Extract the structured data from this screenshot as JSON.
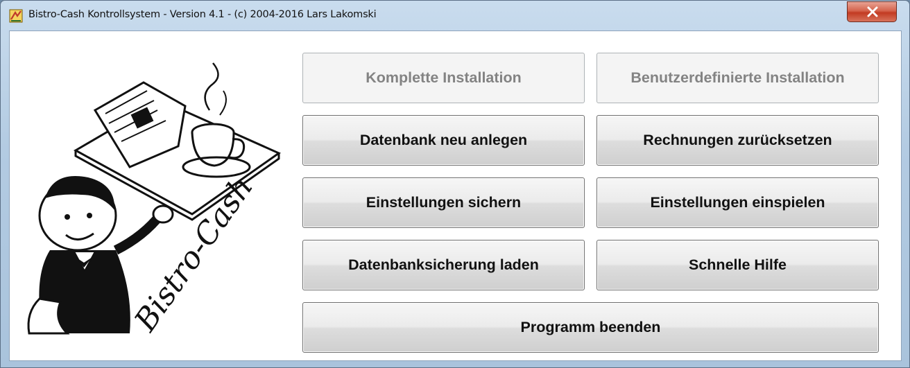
{
  "window": {
    "title": "Bistro-Cash Kontrollsystem - Version 4.1 - (c) 2004-2016 Lars Lakomski",
    "app_icon": "bistro-cash-app-icon",
    "close_icon": "close-x-icon"
  },
  "logo": {
    "text": "Bistro-Cash",
    "image": "waiter-with-tray-illustration"
  },
  "buttons": {
    "complete_install": {
      "label": "Komplette Installation",
      "enabled": false
    },
    "custom_install": {
      "label": "Benutzerdefinierte Installation",
      "enabled": false
    },
    "new_database": {
      "label": "Datenbank neu anlegen",
      "enabled": true
    },
    "reset_invoices": {
      "label": "Rechnungen zurücksetzen",
      "enabled": true
    },
    "save_settings": {
      "label": "Einstellungen sichern",
      "enabled": true
    },
    "load_settings": {
      "label": "Einstellungen einspielen",
      "enabled": true
    },
    "load_backup": {
      "label": "Datenbanksicherung laden",
      "enabled": true
    },
    "quick_help": {
      "label": "Schnelle Hilfe",
      "enabled": true
    },
    "exit": {
      "label": "Programm beenden",
      "enabled": true
    }
  }
}
